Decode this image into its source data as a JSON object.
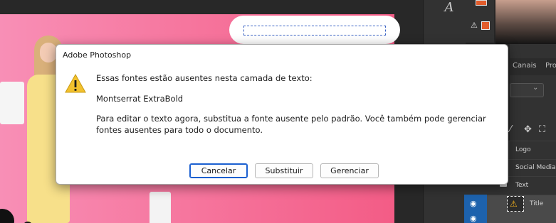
{
  "dialog": {
    "title": "Adobe Photoshop",
    "message_intro": "Essas fontes estão ausentes nesta camada de texto:",
    "missing_font": "Montserrat ExtraBold",
    "message_body": "Para editar o texto agora, substitua a fonte ausente pelo padrão. Você também pode gerenciar fontes ausentes para todo o documento.",
    "buttons": {
      "cancel": "Cancelar",
      "substitute": "Substituir",
      "manage": "Gerenciar"
    },
    "icon": "warning-triangle"
  },
  "tools": {
    "glyph_tool": "A"
  },
  "panel": {
    "tabs": [
      "Canais",
      "Pro"
    ],
    "lock_icons": [
      "brush-icon",
      "move-icon",
      "crop-icon"
    ]
  },
  "layers": [
    {
      "name": "Logo"
    },
    {
      "name": "Social Media"
    },
    {
      "name": "Text"
    },
    {
      "name": "Title",
      "selected": true,
      "warning": true
    }
  ],
  "colors": {
    "foreground": "#e25c2b",
    "artboard_pink": "#f6779f",
    "selection_blue": "#1d62ad",
    "default_button_border": "#1a5fd0"
  }
}
